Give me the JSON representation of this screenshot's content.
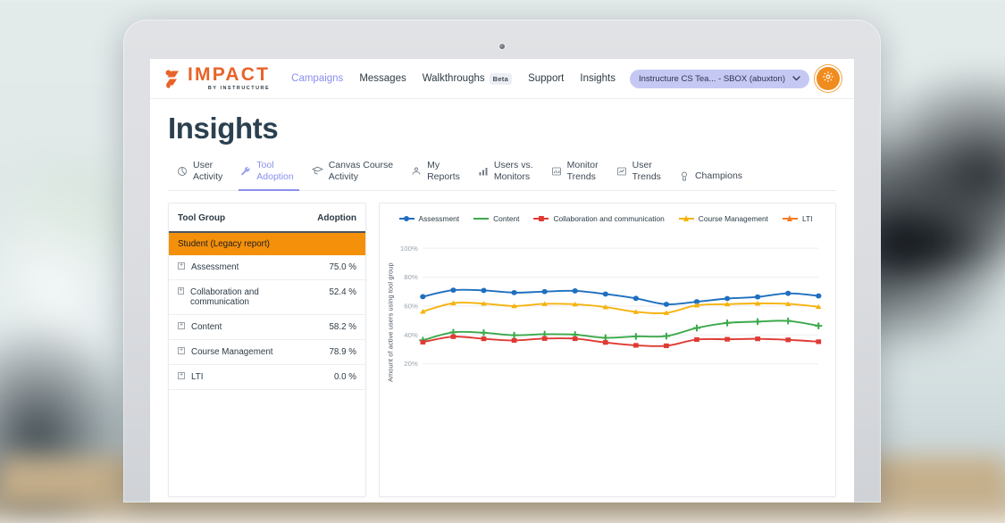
{
  "header": {
    "logo_text": "IMPACT",
    "logo_sub": "BY INSTRUCTURE",
    "nav": [
      {
        "label": "Campaigns",
        "active": true
      },
      {
        "label": "Messages",
        "active": false
      },
      {
        "label": "Walkthroughs",
        "badge": "Beta",
        "active": false
      },
      {
        "label": "Support",
        "active": false
      },
      {
        "label": "Insights",
        "active": false
      }
    ],
    "org_selector": {
      "value": "Instructure CS Tea... - SBOX (abuxton)",
      "chevron": "chevron-down-icon"
    },
    "settings_icon": "gear-icon"
  },
  "page": {
    "title": "Insights"
  },
  "tabs": [
    {
      "line1": "User",
      "line2": "Activity",
      "icon": "pie-chart-icon",
      "active": false
    },
    {
      "line1": "Tool",
      "line2": "Adoption",
      "icon": "wrench-icon",
      "active": true
    },
    {
      "line1": "Canvas Course",
      "line2": "Activity",
      "icon": "graduation-cap-icon",
      "active": false
    },
    {
      "line1": "My",
      "line2": "Reports",
      "icon": "person-icon",
      "active": false
    },
    {
      "line1": "Users vs.",
      "line2": "Monitors",
      "icon": "bar-chart-icon",
      "active": false
    },
    {
      "line1": "Monitor",
      "line2": "Trends",
      "icon": "bar-chart-icon",
      "active": false
    },
    {
      "line1": "User",
      "line2": "Trends",
      "icon": "line-chart-icon",
      "active": false
    },
    {
      "line1": "Champions",
      "line2": "",
      "icon": "medal-icon",
      "active": false
    }
  ],
  "table": {
    "columns": [
      "Tool Group",
      "Adoption"
    ],
    "group_row": "Student (Legacy report)",
    "group_row_color": "#f5900b",
    "rows": [
      {
        "name": "Assessment",
        "adoption": "75.0 %"
      },
      {
        "name": "Collaboration and communication",
        "adoption": "52.4 %"
      },
      {
        "name": "Content",
        "adoption": "58.2 %"
      },
      {
        "name": "Course Management",
        "adoption": "78.9 %"
      },
      {
        "name": "LTI",
        "adoption": "0.0 %"
      }
    ]
  },
  "chart_data": {
    "type": "line",
    "title": "",
    "xlabel": "",
    "ylabel": "Amount of active users using tool group",
    "ylim": [
      0,
      110
    ],
    "ytick_labels": [
      "100%",
      "80%",
      "60%",
      "40%",
      "20%"
    ],
    "ytick_values": [
      100,
      80,
      60,
      40,
      20
    ],
    "grid": true,
    "legend_position": "top-center",
    "x": [
      1,
      2,
      3,
      4,
      5,
      6,
      7,
      8,
      9,
      10,
      11,
      12,
      13,
      14
    ],
    "series": [
      {
        "name": "Assessment",
        "color": "#1f6fbf",
        "marker": "circle",
        "values": [
          66.5,
          71.0,
          70.8,
          69.3,
          70.0,
          70.5,
          68.3,
          65.3,
          61.2,
          63.0,
          65.2,
          66.3,
          68.8,
          67.0
        ]
      },
      {
        "name": "Content",
        "color": "#3ca94b",
        "marker": "cross",
        "values": [
          36.3,
          41.8,
          41.5,
          39.8,
          40.5,
          40.2,
          38.0,
          39.0,
          39.2,
          44.8,
          48.3,
          49.2,
          49.7,
          46.3
        ]
      },
      {
        "name": "Collaboration and communication",
        "color": "#e03a34",
        "marker": "square",
        "values": [
          35.0,
          38.8,
          37.3,
          36.2,
          37.5,
          37.4,
          34.8,
          32.8,
          32.5,
          36.8,
          37.0,
          37.3,
          36.6,
          35.3
        ]
      },
      {
        "name": "Course Management",
        "color": "#f5b30d",
        "marker": "triangle",
        "values": [
          56.2,
          62.0,
          61.7,
          60.0,
          61.5,
          61.2,
          59.3,
          56.0,
          55.3,
          60.5,
          61.3,
          61.8,
          61.5,
          59.5
        ]
      },
      {
        "name": "LTI",
        "color": "#f57a1f",
        "marker": "triangle",
        "values": [
          0,
          0,
          0,
          0,
          0,
          0,
          0,
          0,
          0,
          0,
          0,
          0,
          0,
          0
        ]
      }
    ]
  }
}
